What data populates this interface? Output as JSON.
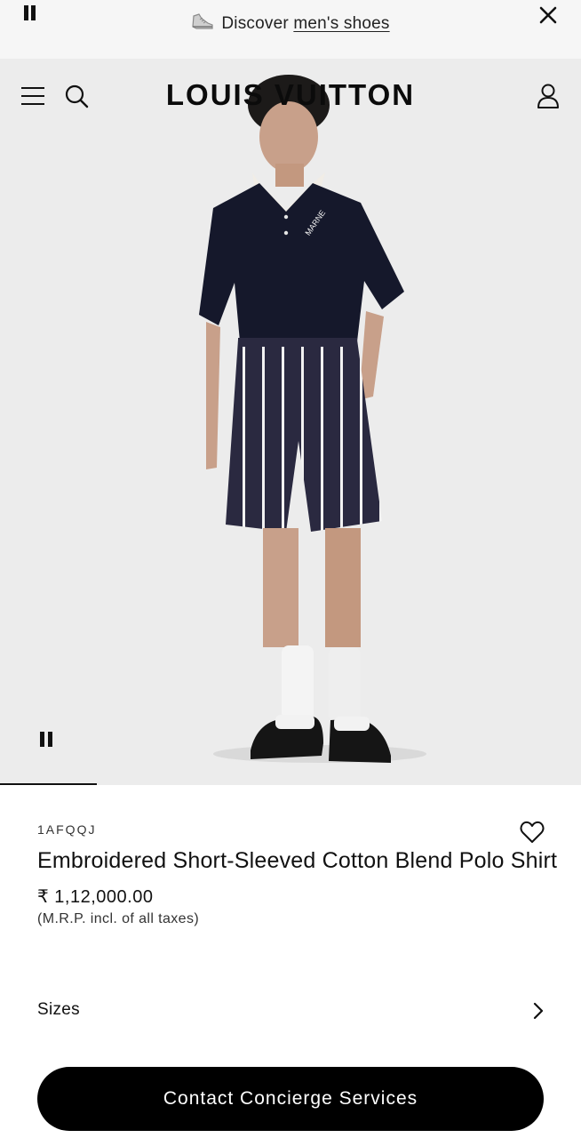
{
  "promo": {
    "icon": "sneaker-icon",
    "prefix": "Discover",
    "link": "men's shoes"
  },
  "header": {
    "logo": "LOUIS VUITTON",
    "menu_icon": "hamburger-icon",
    "search_icon": "search-icon",
    "account_icon": "account-icon"
  },
  "gallery": {
    "controls": "pause-icon",
    "progress": 0.167
  },
  "product": {
    "sku": "1AFQQJ",
    "title": "Embroidered Short-Sleeved Cotton Blend Polo Shirt",
    "price": "₹ 1,12,000.00",
    "tax_note": "(M.R.P. incl. of all taxes)",
    "wishlist_icon": "heart-icon"
  },
  "sizes": {
    "label": "Sizes"
  },
  "cta": {
    "label": "Contact Concierge Services"
  },
  "colors": {
    "banner_bg": "#f6f6f6",
    "hero_bg": "#ececec",
    "cta_bg": "#000000",
    "text": "#111111"
  }
}
